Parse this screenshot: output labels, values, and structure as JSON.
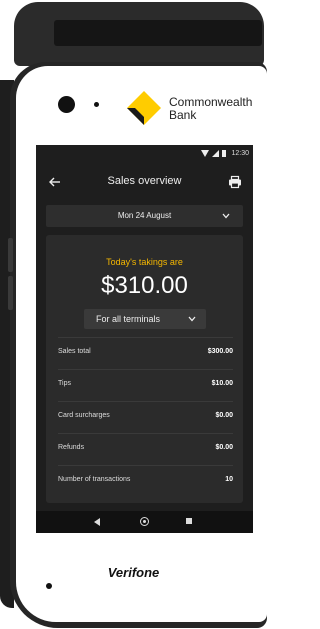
{
  "brand": {
    "bank_name_line1": "Commonwealth",
    "bank_name_line2": "Bank",
    "device_maker": "Verifone",
    "accent_color": "#f5b700"
  },
  "status_bar": {
    "time": "12:30",
    "icons": [
      "wifi-icon",
      "signal-icon",
      "battery-icon"
    ]
  },
  "app_bar": {
    "title": "Sales overview",
    "back_icon": "back-arrow-icon",
    "print_icon": "printer-icon"
  },
  "date_selector": {
    "value": "Mon 24 August",
    "icon": "chevron-down-icon"
  },
  "summary": {
    "label": "Today's takings are",
    "amount": "$310.00",
    "terminal_filter": "For all terminals"
  },
  "rows": [
    {
      "label": "Sales total",
      "value": "$300.00"
    },
    {
      "label": "Tips",
      "value": "$10.00"
    },
    {
      "label": "Card surcharges",
      "value": "$0.00"
    },
    {
      "label": "Refunds",
      "value": "$0.00"
    },
    {
      "label": "Number of transactions",
      "value": "10"
    }
  ],
  "nav_bar": {
    "icons": [
      "nav-back-icon",
      "nav-home-icon",
      "nav-recents-icon"
    ]
  }
}
